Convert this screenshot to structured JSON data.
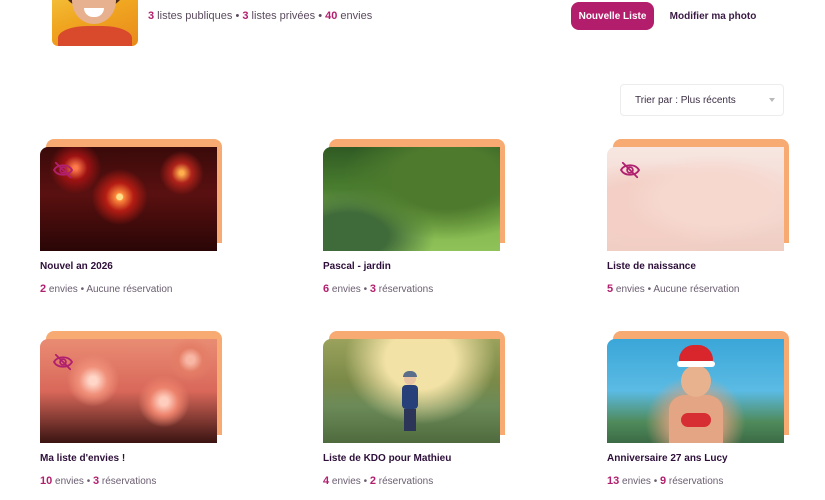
{
  "profile": {
    "stats": [
      {
        "num": "3",
        "text": " listes publiques"
      },
      {
        "num": "3",
        "text": " listes privées"
      },
      {
        "num": "40",
        "text": " envies"
      }
    ],
    "separator": " • "
  },
  "actions": {
    "new_list_label": "Nouvelle Liste",
    "edit_photo_label": "Modifier ma photo"
  },
  "sort": {
    "label": "Trier par : Plus récents"
  },
  "lists": [
    {
      "title": "Nouvel an 2026",
      "wishes": "2",
      "wishes_label": " envies",
      "res_num": "",
      "res_label": "Aucune réservation",
      "private": true,
      "image": "fireworks"
    },
    {
      "title": "Pascal - jardin",
      "wishes": "6",
      "wishes_label": " envies",
      "res_num": "3",
      "res_label": " réservations",
      "private": false,
      "image": "garden"
    },
    {
      "title": "Liste de naissance",
      "wishes": "5",
      "wishes_label": " envies",
      "res_num": "",
      "res_label": "Aucune réservation",
      "private": true,
      "image": "baby-feet"
    },
    {
      "title": "Ma liste d'envies !",
      "wishes": "10",
      "wishes_label": " envies",
      "res_num": "3",
      "res_label": " réservations",
      "private": true,
      "image": "flowers"
    },
    {
      "title": "Liste de KDO pour Mathieu",
      "wishes": "4",
      "wishes_label": " envies",
      "res_num": "2",
      "res_label": " réservations",
      "private": false,
      "image": "boy-in-grass"
    },
    {
      "title": "Anniversaire 27 ans Lucy",
      "wishes": "13",
      "wishes_label": " envies",
      "res_num": "9",
      "res_label": " réservations",
      "private": false,
      "image": "beach-santa-hat"
    }
  ],
  "colors": {
    "primary": "#b21d6c",
    "accent": "#f7ab72",
    "text": "#2d0f3a",
    "private_icon": "#b1206f"
  },
  "icons": {
    "private": "eye-slash-icon",
    "sort_caret": "chevron-down-icon"
  }
}
